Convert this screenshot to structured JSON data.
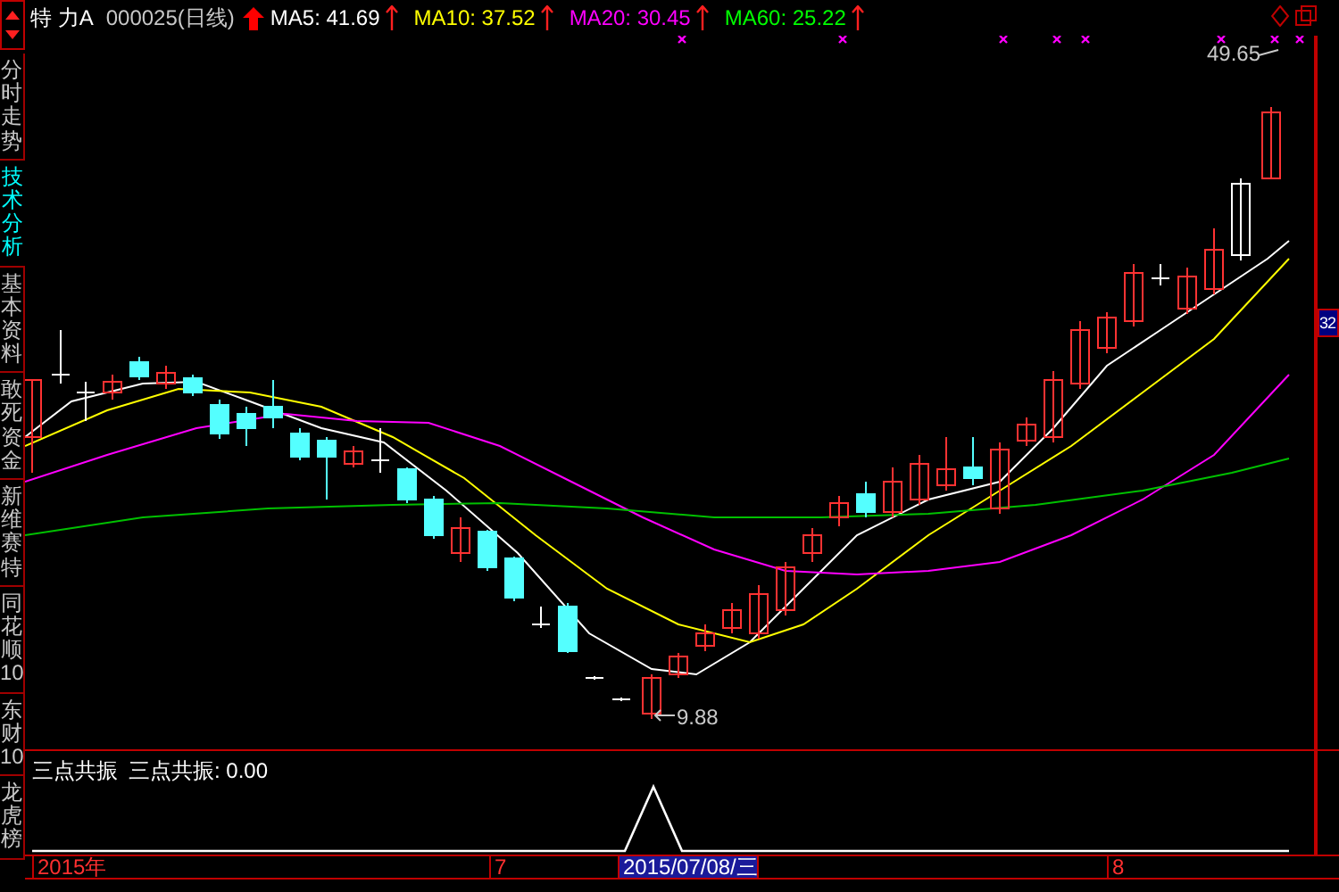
{
  "header": {
    "name": "特 力A",
    "code": "000025(日线)",
    "indicators": [
      {
        "label": "MA5: 41.69",
        "color": "#ffffff"
      },
      {
        "label": "MA10: 37.52",
        "color": "#ffff00"
      },
      {
        "label": "MA20: 30.45",
        "color": "#ff00ff"
      },
      {
        "label": "MA60: 25.22",
        "color": "#00ff00"
      }
    ]
  },
  "sidebar": {
    "tabs": [
      {
        "label": "分时走势",
        "selected": false
      },
      {
        "label": "技术分析",
        "selected": true
      },
      {
        "label": "基本资料",
        "selected": false
      },
      {
        "label": "敢死资金",
        "selected": false
      },
      {
        "label": "新维赛特",
        "selected": false
      },
      {
        "label": "同花顺10",
        "selected": false
      },
      {
        "label": "东财10",
        "selected": false
      },
      {
        "label": "龙虎榜",
        "selected": false
      }
    ]
  },
  "chart": {
    "high_label": "49.65",
    "low_label": "9.88",
    "price_tag": "32"
  },
  "indicator_panel": {
    "title": "三点共振",
    "reading": "三点共振: 0.00"
  },
  "time_axis": {
    "labels": [
      {
        "text": "2015年",
        "selected": false
      },
      {
        "text": "7",
        "selected": false
      },
      {
        "text": "2015/07/08/三",
        "selected": true
      },
      {
        "text": "8",
        "selected": false
      }
    ]
  }
}
